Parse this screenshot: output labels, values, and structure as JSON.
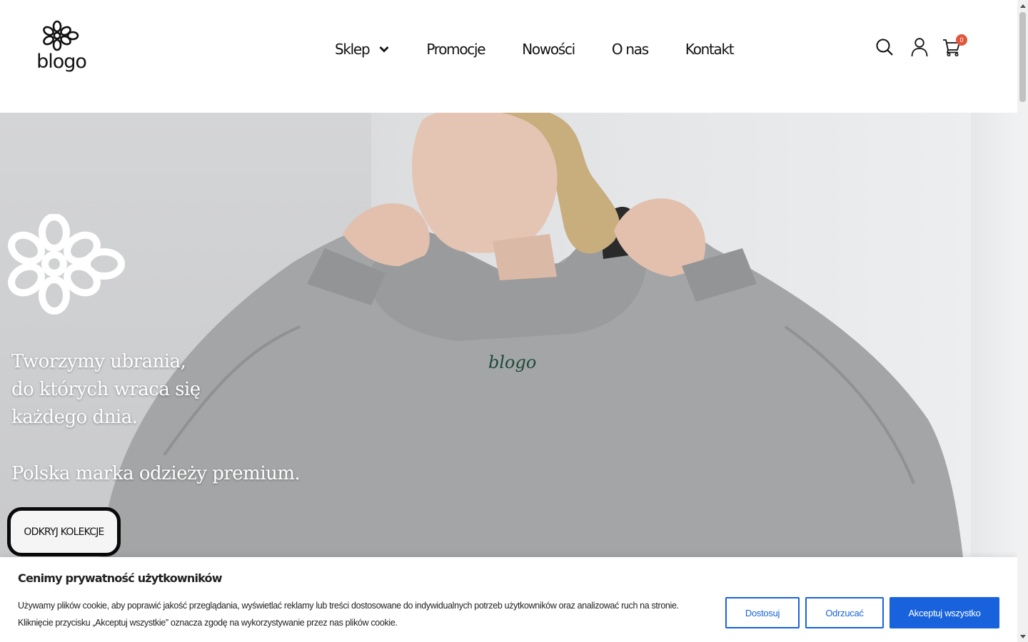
{
  "header": {
    "logo_text": "blogo",
    "nav": [
      {
        "label": "Sklep",
        "has_dropdown": true
      },
      {
        "label": "Promocje"
      },
      {
        "label": "Nowości"
      },
      {
        "label": "O nas"
      },
      {
        "label": "Kontakt"
      }
    ],
    "icons": [
      "search-icon",
      "user-icon",
      "cart-icon"
    ],
    "cart_count": "0"
  },
  "hero": {
    "headline_lines": [
      "Tworzymy ubrania,",
      "do których wraca się",
      "każdego dnia."
    ],
    "subheadline": "Polska marka odzieży premium.",
    "cta_label": "ODKRYJ KOLEKCJE",
    "hoodie_print": "blogo"
  },
  "cookie_banner": {
    "title": "Cenimy prywatność użytkowników",
    "text_line1": "Używamy plików cookie, aby poprawić jakość przeglądania, wyświetlać reklamy lub treści dostosowane do indywidualnych potrzeb użytkowników oraz analizować ruch na stronie.",
    "text_line2": "Kliknięcie przycisku „Akceptuj wszystkie” oznacza zgodę na wykorzystywanie przez nas plików cookie.",
    "customize_label": "Dostosuj",
    "reject_label": "Odrzucać",
    "accept_label": "Akceptuj wszystko"
  },
  "colors": {
    "accept_bg": "#1863dc",
    "badge": "#e0573b",
    "hoodie": "#a3a5a6",
    "print": "#1f4a3a"
  }
}
